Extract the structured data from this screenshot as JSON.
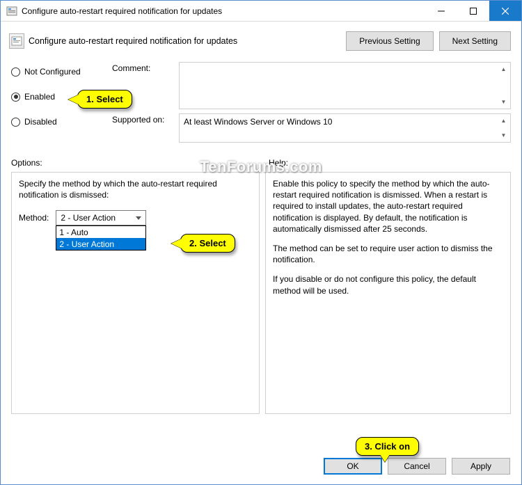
{
  "window": {
    "title": "Configure auto-restart required notification for updates"
  },
  "header": {
    "title": "Configure auto-restart required notification for updates",
    "prev_btn": "Previous Setting",
    "next_btn": "Next Setting"
  },
  "radios": {
    "not_configured": "Not Configured",
    "enabled": "Enabled",
    "disabled": "Disabled"
  },
  "form": {
    "comment_label": "Comment:",
    "supported_label": "Supported on:",
    "supported_text": "At least Windows Server or Windows 10"
  },
  "labels": {
    "options": "Options:",
    "help": "Help:"
  },
  "options": {
    "specify_text": "Specify the method by which the auto-restart required notification is dismissed:",
    "method_label": "Method:",
    "method_selected": "2 - User Action",
    "method_items": [
      "1 - Auto",
      "2 - User Action"
    ]
  },
  "help": {
    "p1": "Enable this policy to specify the method by which the auto-restart required notification is dismissed. When a restart is required to install updates, the auto-restart required notification is displayed. By default, the notification is automatically dismissed after 25 seconds.",
    "p2": "The method can be set to require user action to dismiss the notification.",
    "p3": "If you disable or do not configure this policy, the default method will be used."
  },
  "buttons": {
    "ok": "OK",
    "cancel": "Cancel",
    "apply": "Apply"
  },
  "callouts": {
    "c1": "1. Select",
    "c2": "2. Select",
    "c3": "3. Click on"
  },
  "watermark": "TenForums.com"
}
